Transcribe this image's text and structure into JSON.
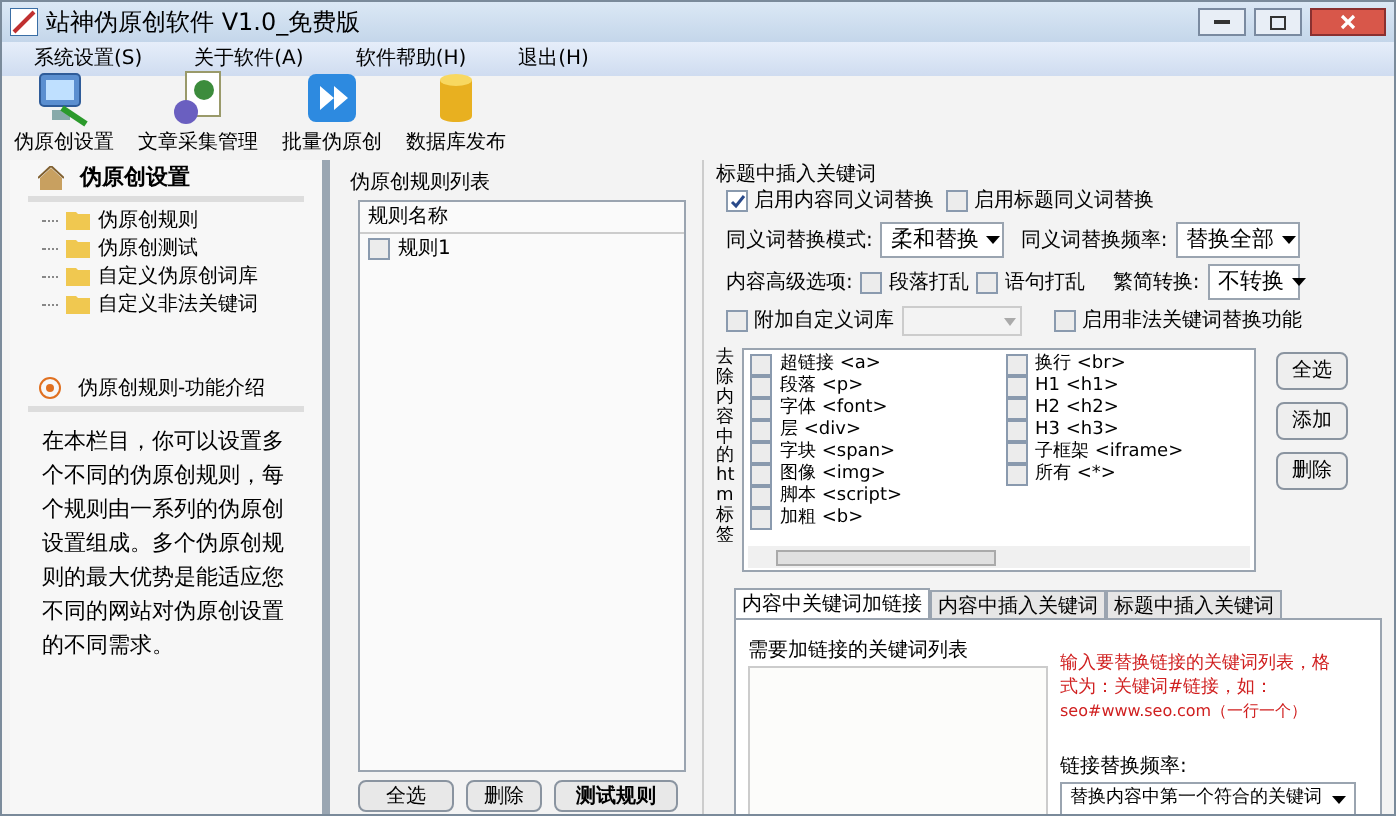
{
  "window": {
    "title": "站神伪原创软件 V1.0_免费版"
  },
  "menu": [
    "系统设置(S)",
    "关于软件(A)",
    "软件帮助(H)",
    "退出(H)"
  ],
  "toolbar": [
    {
      "kind": "monitor",
      "label": "伪原创设置"
    },
    {
      "kind": "document",
      "label": "文章采集管理"
    },
    {
      "kind": "play",
      "label": "批量伪原创"
    },
    {
      "kind": "database",
      "label": "数据库发布"
    }
  ],
  "sidebar": {
    "title": "伪原创设置",
    "items": [
      {
        "label": "伪原创规则"
      },
      {
        "label": "伪原创测试"
      },
      {
        "label": "自定义伪原创词库"
      },
      {
        "label": "自定义非法关键词"
      }
    ],
    "info_title": "伪原创规则-功能介绍",
    "info_text": "在本栏目，你可以设置多个不同的伪原创规则，每个规则由一系列的伪原创设置组成。多个伪原创规则的最大优势是能适应您不同的网站对伪原创设置的不同需求。"
  },
  "rules": {
    "title": "伪原创规则列表",
    "column": "规则名称",
    "rows": [
      {
        "label": "规则1",
        "checked": false
      }
    ],
    "buttons": [
      "全选",
      "删除",
      "测试规则"
    ]
  },
  "settings": {
    "title": "标题中插入关键词",
    "options": [
      {
        "label": "启用内容同义词替换",
        "checked": true
      },
      {
        "label": "启用标题同义词替换",
        "checked": false
      }
    ],
    "mode_label": "同义词替换模式:",
    "mode_value": "柔和替换",
    "freq_label": "同义词替换频率:",
    "freq_value": "替换全部",
    "advanced_label": "内容高级选项:",
    "advanced": [
      {
        "label": "段落打乱",
        "checked": false
      },
      {
        "label": "语句打乱",
        "checked": false
      }
    ],
    "convert_label": "繁简转换:",
    "convert_value": "不转换",
    "custom_lib": {
      "label": "附加自定义词库",
      "checked": false
    },
    "illegal": {
      "label": "启用非法关键词替换功能",
      "checked": false
    }
  },
  "tags": {
    "label": "去除内容中的htm标签",
    "columns": [
      [
        {
          "label": "超链接 <a>",
          "checked": false
        },
        {
          "label": "段落 <p>",
          "checked": false
        },
        {
          "label": "字体 <font>",
          "checked": false
        },
        {
          "label": "层 <div>",
          "checked": false
        },
        {
          "label": "字块 <span>",
          "checked": false
        },
        {
          "label": "图像 <img>",
          "checked": false
        },
        {
          "label": "脚本 <script>",
          "checked": false
        },
        {
          "label": "加粗 <b>",
          "checked": false
        }
      ],
      [
        {
          "label": "换行 <br>",
          "checked": false
        },
        {
          "label": "H1 <h1>",
          "checked": false
        },
        {
          "label": "H2 <h2>",
          "checked": false
        },
        {
          "label": "H3 <h3>",
          "checked": false
        },
        {
          "label": "子框架 <iframe>",
          "checked": false
        },
        {
          "label": "所有 <*>",
          "checked": false
        }
      ]
    ],
    "buttons": [
      "全选",
      "添加",
      "删除"
    ]
  },
  "tabs": [
    {
      "label": "内容中关键词加链接",
      "selected": true
    },
    {
      "label": "内容中插入关键词",
      "selected": false
    },
    {
      "label": "标题中插入关键词",
      "selected": false
    }
  ],
  "link_panel": {
    "list_label": "需要加链接的关键词列表",
    "hint": "输入要替换链接的关键词列表，格式为：关键词#链接，如：",
    "hint_example": "seo#www.seo.com（一行一个）",
    "freq_label": "链接替换频率:",
    "freq_value": "替换内容中第一个符合的关键词"
  }
}
